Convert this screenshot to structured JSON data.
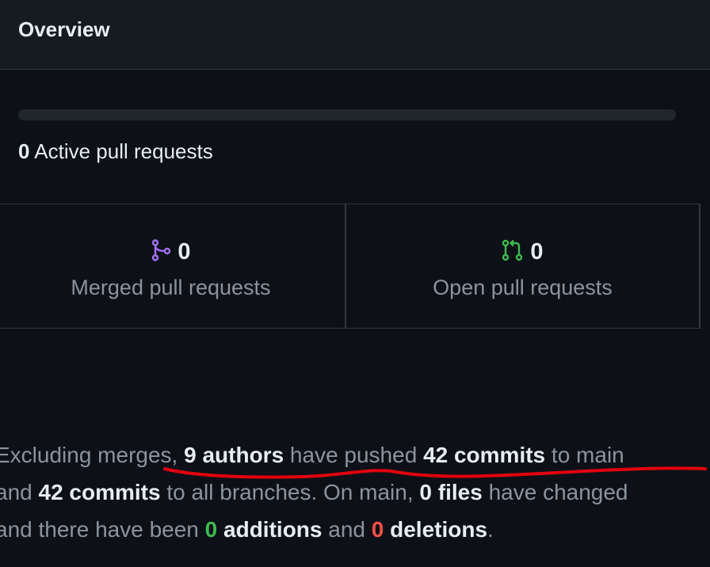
{
  "header": {
    "title": "Overview"
  },
  "activity": {
    "active_count": "0",
    "active_label": "Active pull requests",
    "merged_fraction": 0
  },
  "stats": {
    "merged": {
      "count": "0",
      "label": "Merged pull requests",
      "icon": "git-merge-icon",
      "color": "#a371f7"
    },
    "open": {
      "count": "0",
      "label": "Open pull requests",
      "icon": "git-pull-request-icon",
      "color": "#3fb950"
    }
  },
  "summary": {
    "t1": "Excluding merges, ",
    "authors": "9 authors",
    "t2": " have pushed ",
    "commits_main": "42 commits",
    "t3": " to main",
    "t4": "and ",
    "commits_all": "42 commits",
    "t5": " to all branches. On main, ",
    "files": "0 files",
    "t6": " have changed",
    "t7": "and there have been ",
    "additions_num": "0",
    "additions_label": " additions",
    "t8": " and ",
    "deletions_num": "0",
    "deletions_label": " deletions",
    "t9": "."
  },
  "annotation_color": "#e3000f"
}
